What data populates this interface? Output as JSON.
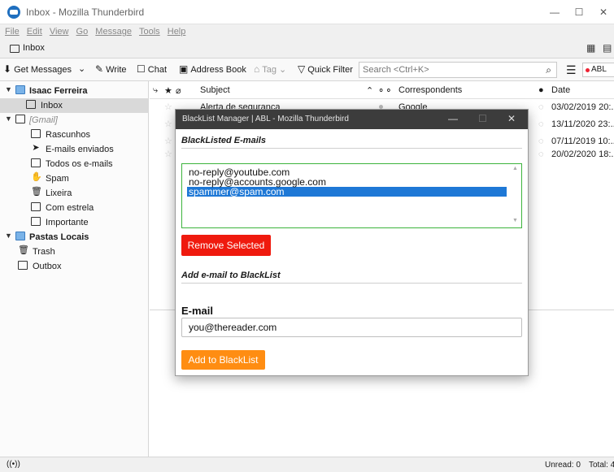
{
  "window": {
    "title": "Inbox - Mozilla Thunderbird",
    "minimize": "—",
    "maximize": "☐",
    "close": "✕"
  },
  "menu": [
    "File",
    "Edit",
    "View",
    "Go",
    "Message",
    "Tools",
    "Help"
  ],
  "tab": {
    "label": "Inbox"
  },
  "toolbar": {
    "get_messages": "Get Messages",
    "write": "Write",
    "chat": "Chat",
    "address_book": "Address Book",
    "tag": "Tag",
    "quick_filter": "Quick Filter",
    "search_placeholder": "Search <Ctrl+K>",
    "abl": "ABL"
  },
  "folders": {
    "account": "Isaac Ferreira",
    "inbox": "Inbox",
    "gmail": "[Gmail]",
    "drafts": "Rascunhos",
    "sent": "E-mails enviados",
    "all_mail": "Todos os e-mails",
    "spam": "Spam",
    "trash_pt": "Lixeira",
    "starred": "Com estrela",
    "important": "Importante",
    "local": "Pastas Locais",
    "trash": "Trash",
    "outbox": "Outbox"
  },
  "columns": {
    "subject": "Subject",
    "correspondents": "Correspondents",
    "date": "Date"
  },
  "messages": [
    {
      "subject": "Alerta de segurança",
      "correspondent": "Google",
      "date": "03/02/2019 20:..."
    },
    {
      "subject": "",
      "correspondent": "",
      "date": "13/11/2020 23:..."
    },
    {
      "subject": "",
      "correspondent": "",
      "date": "07/11/2019 10:..."
    },
    {
      "subject": "",
      "correspondent": "",
      "date": "20/02/2020 18:..."
    }
  ],
  "status": {
    "unread": "Unread: 0",
    "total": "Total: 4"
  },
  "dialog": {
    "title": "BlackList Manager | ABL - Mozilla Thunderbird",
    "blacklisted_header": "BlackListed E-mails",
    "emails": [
      "no-reply@youtube.com",
      "no-reply@accounts.google.com",
      "spammer@spam.com"
    ],
    "selected_index": 2,
    "remove_button": "Remove Selected",
    "add_header": "Add e-mail to BlackList",
    "email_label": "E-mail",
    "email_value": "you@thereader.com",
    "add_button": "Add to BlackList",
    "colors": {
      "remove": "#ef1a0e",
      "add": "#ff8d12",
      "list_border": "#3cb43c",
      "selection": "#1e78d6"
    }
  }
}
